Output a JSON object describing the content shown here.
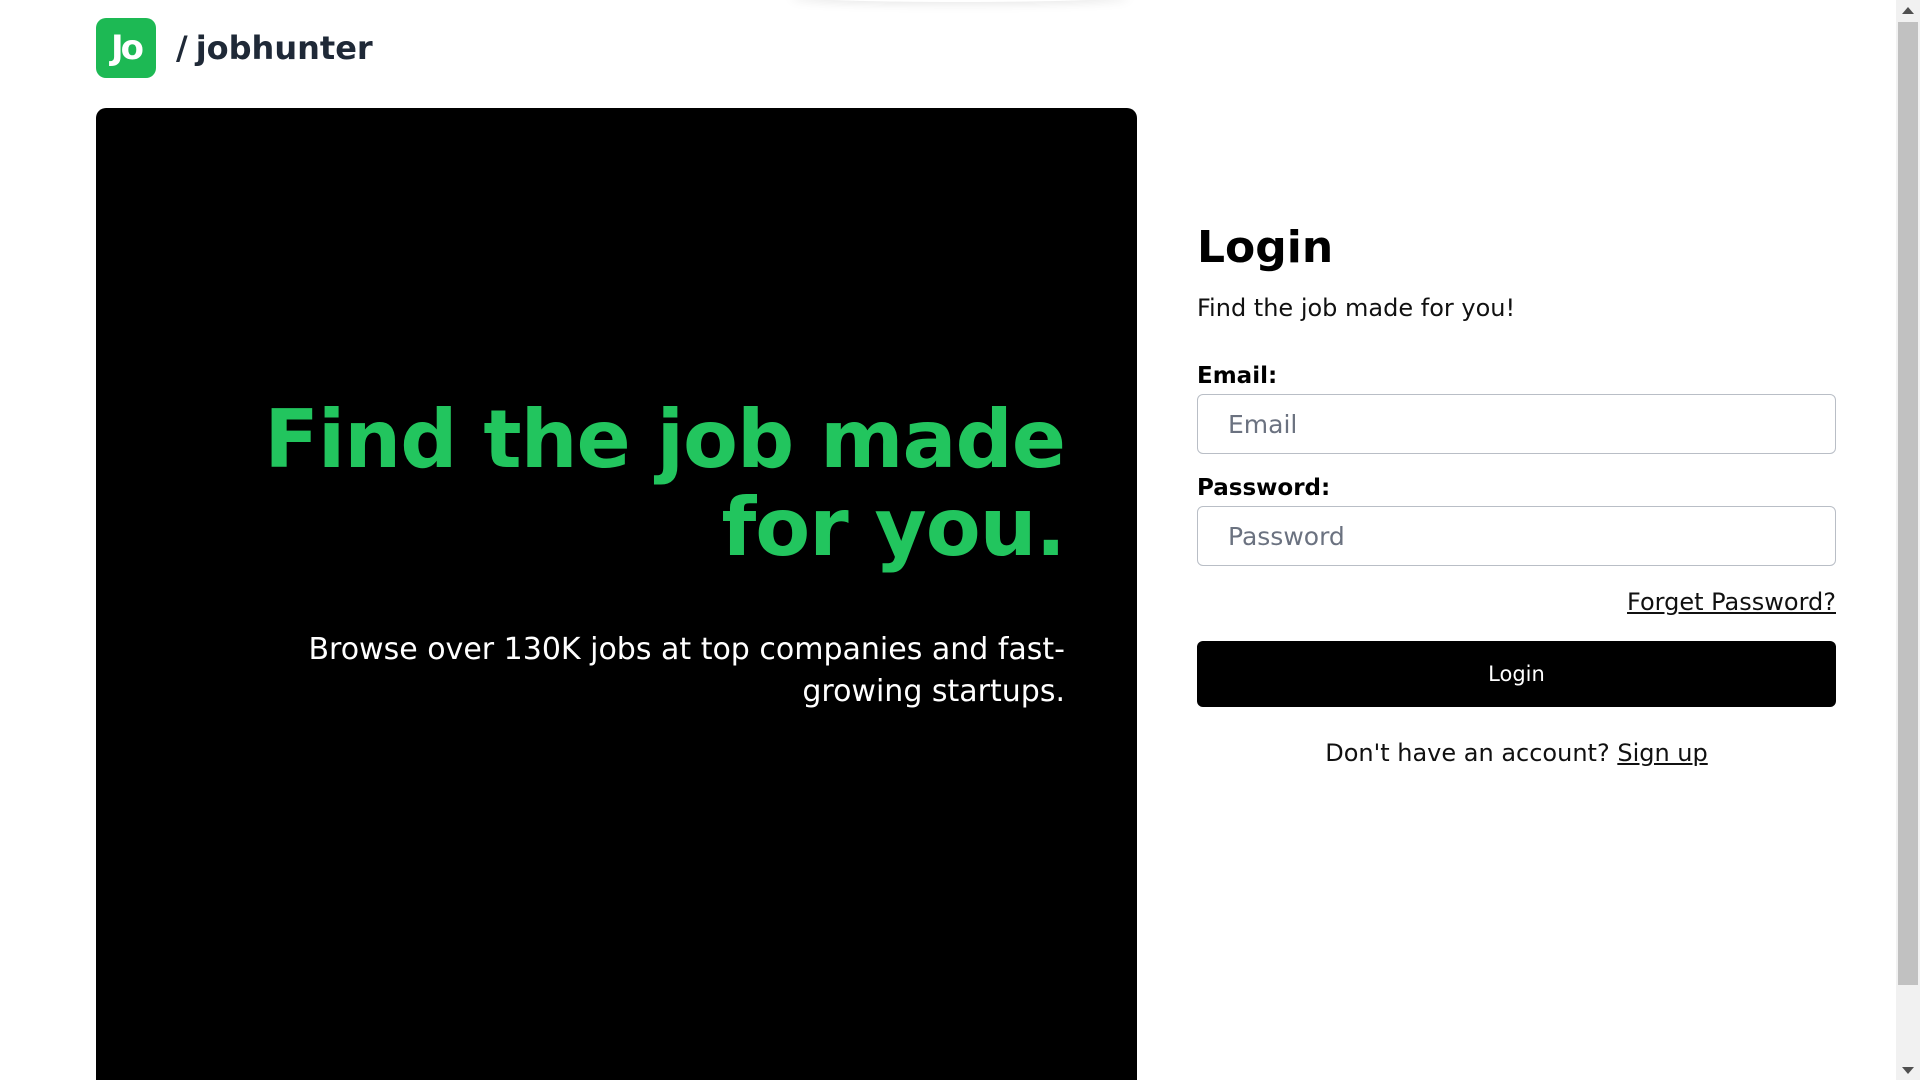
{
  "header": {
    "logo_text": "Jo",
    "brand_slash": "/",
    "brand_name": "jobhunter"
  },
  "hero": {
    "title": "Find the job made for you.",
    "subtitle": "Browse over 130K jobs at top companies and fast-growing startups."
  },
  "login": {
    "title": "Login",
    "subtitle": "Find the job made for you!",
    "email_label": "Email:",
    "email_placeholder": "Email",
    "password_label": "Password:",
    "password_placeholder": "Password",
    "forgot_label": "Forget Password?",
    "button_label": "Login",
    "signup_prompt": "Don't have an account?",
    "signup_label": "Sign up"
  },
  "colors": {
    "brand_green": "#1db954",
    "hero_title_green": "#22c55e",
    "hero_background": "#000000",
    "button_background": "#000000"
  },
  "icons": {
    "logo": "jobhunter-logo-icon",
    "scroll_up": "scroll-up-arrow-icon",
    "scroll_down": "scroll-down-arrow-icon"
  }
}
